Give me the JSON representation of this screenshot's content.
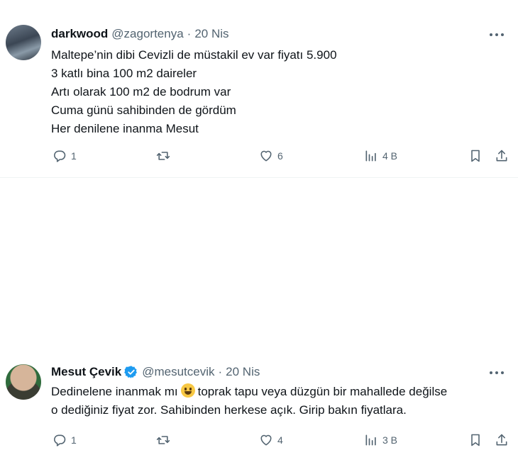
{
  "tweets": [
    {
      "name": "darkwood",
      "handle": "@zagortenya",
      "separator": "·",
      "date": "20 Nis",
      "verified": false,
      "lines": [
        "Maltepe’nin dibi Cevizli de müstakil ev var fiyatı 5.900",
        "3 katlı bina 100 m2 daireler",
        "Artı olarak 100 m2 de bodrum var",
        "Cuma günü sahibinden de gördüm",
        "Her denilene inanma Mesut"
      ],
      "stats": {
        "replies": "1",
        "retweets": "",
        "likes": "6",
        "views": "4 B"
      }
    },
    {
      "name": "Mesut Çevik",
      "handle": "@mesutcevik",
      "separator": "·",
      "date": "20 Nis",
      "verified": true,
      "line1_before_emoji": "Dedinelene inanmak mı",
      "line1_after_emoji": "toprak tapu veya düzgün bir mahallede değilse",
      "line2": "o dediğiniz fiyat zor. Sahibinden herkese açık. Girip bakın fiyatlara.",
      "stats": {
        "replies": "1",
        "retweets": "",
        "likes": "4",
        "views": "3 B"
      }
    }
  ],
  "icons": {
    "reply": "reply-icon",
    "retweet": "retweet-icon",
    "like": "heart-icon",
    "views": "views-icon",
    "bookmark": "bookmark-icon",
    "share": "share-icon",
    "more": "more-icon",
    "verified": "verified-badge-icon",
    "emoji": "grinning-emoji-icon"
  },
  "colors": {
    "text": "#0f1419",
    "secondary": "#536471",
    "verified": "#1d9bf0",
    "divider": "#eff3f4"
  }
}
